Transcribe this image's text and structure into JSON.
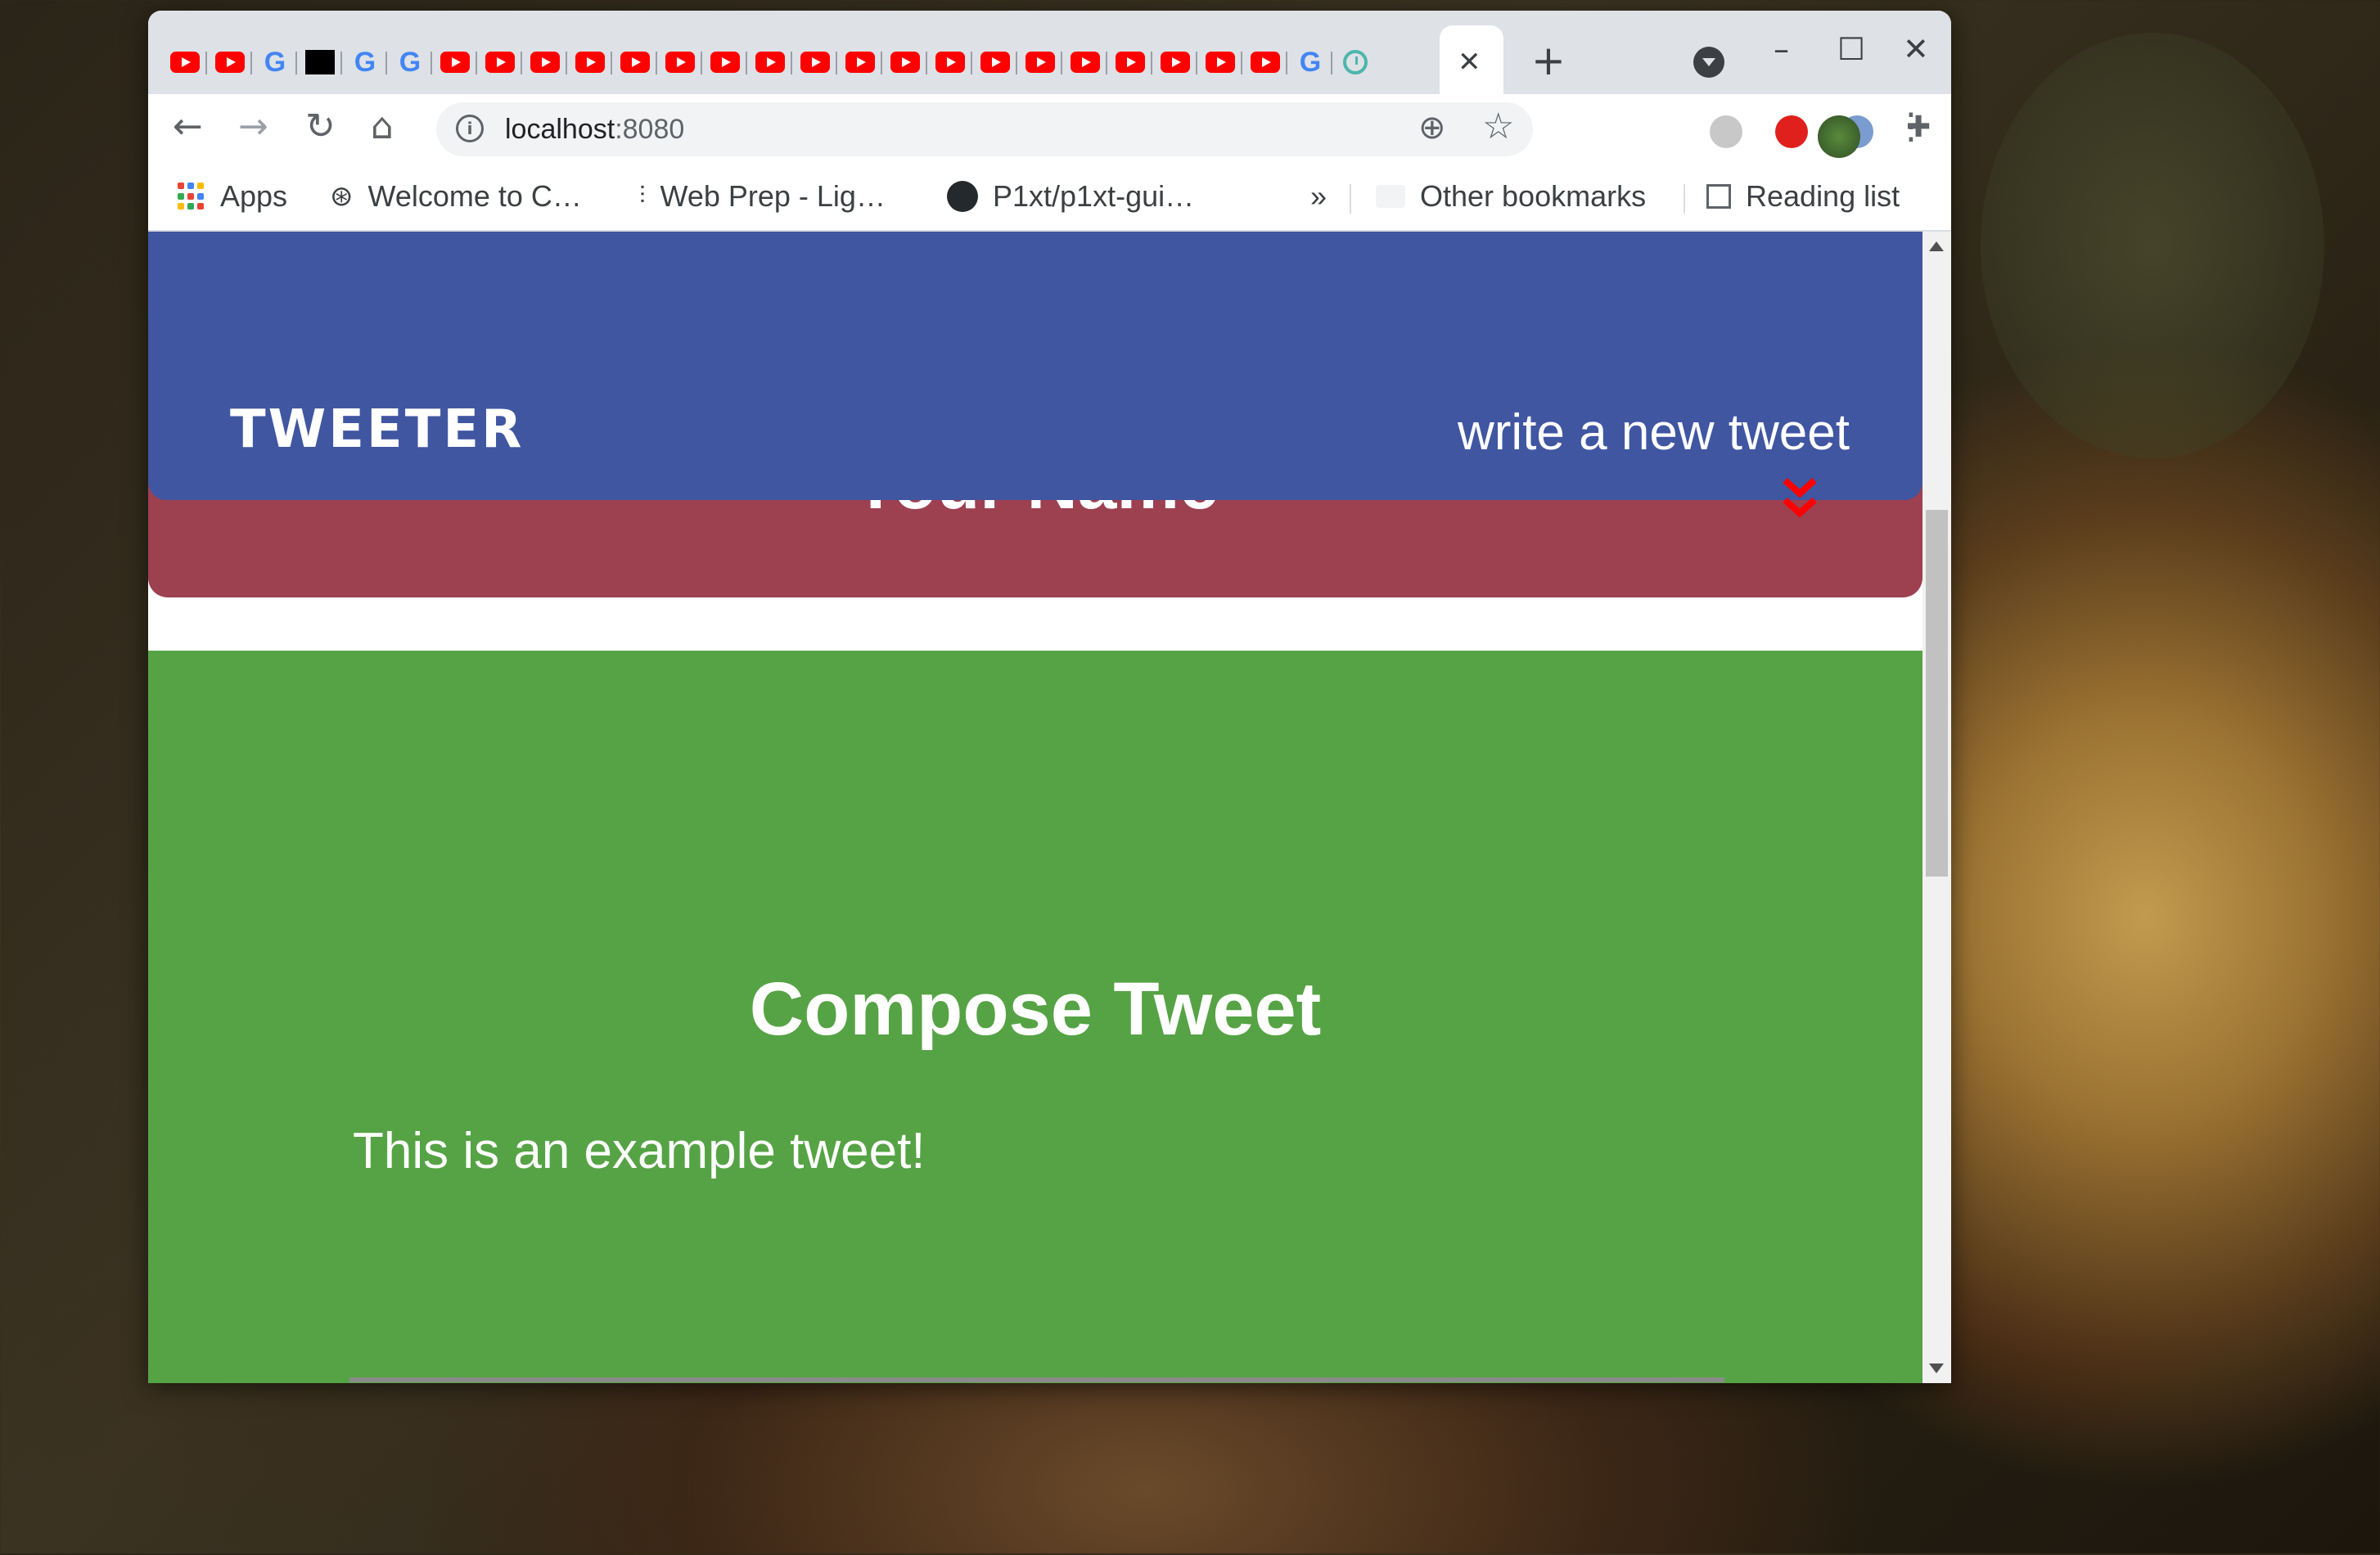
{
  "browser": {
    "tabs": {
      "favicons": [
        "youtube",
        "youtube",
        "google",
        "black-logo",
        "google",
        "google",
        "youtube",
        "youtube",
        "youtube",
        "youtube",
        "youtube",
        "youtube",
        "youtube",
        "youtube",
        "youtube",
        "youtube",
        "youtube",
        "youtube",
        "youtube",
        "youtube",
        "youtube",
        "youtube",
        "youtube",
        "youtube",
        "youtube",
        "google",
        "clock"
      ],
      "close_glyph": "✕",
      "new_tab_glyph": "+"
    },
    "window_controls": {
      "minimize": "–",
      "maximize": "☐",
      "close": "✕"
    },
    "toolbar": {
      "back": "←",
      "forward": "→",
      "reload": "↻",
      "home": "⌂",
      "url_host": "localhost",
      "url_port": ":8080",
      "zoom": "⊕",
      "star": "☆",
      "menu": "⋮"
    },
    "bookmarks": {
      "apps": "Apps",
      "item1": "Welcome to C…",
      "item2": "Web Prep - Lig…",
      "item3": "P1xt/p1xt-gui…",
      "overflow": "»",
      "other": "Other bookmarks",
      "reading_list": "Reading list"
    }
  },
  "page": {
    "nav": {
      "brand": "TWEETER",
      "write_link": "write a new tweet"
    },
    "profile": {
      "name": "Your Name"
    },
    "compose": {
      "title": "Compose Tweet",
      "tweet_text": "This is an example tweet!"
    }
  },
  "colors": {
    "nav_bg": "#4056a1",
    "profile_bg": "#9d4050",
    "compose_bg": "#56a345",
    "chevron": "#ff0000"
  }
}
